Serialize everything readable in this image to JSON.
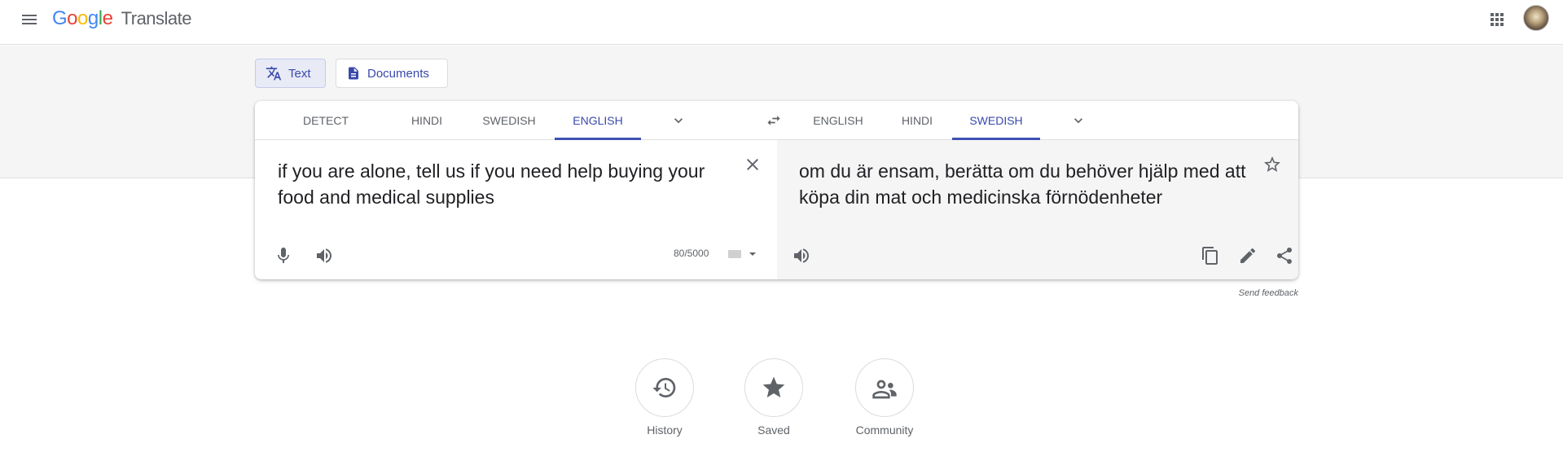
{
  "header": {
    "logo_letters": [
      "G",
      "o",
      "o",
      "g",
      "l",
      "e"
    ],
    "product_name": "Translate",
    "icons": [
      "menu-icon",
      "apps-grid-icon",
      "avatar"
    ]
  },
  "modes": [
    {
      "label": "Text",
      "icon": "translate-icon",
      "active": true
    },
    {
      "label": "Documents",
      "icon": "document-icon",
      "active": false
    }
  ],
  "source_langs": [
    {
      "label": "Detect language",
      "active": false
    },
    {
      "label": "Hindi",
      "active": false
    },
    {
      "label": "Swedish",
      "active": false
    },
    {
      "label": "English",
      "active": true
    }
  ],
  "target_langs": [
    {
      "label": "English",
      "active": false
    },
    {
      "label": "Hindi",
      "active": false
    },
    {
      "label": "Swedish",
      "active": true
    }
  ],
  "source": {
    "text": "if you are alone, tell us if you need help buying your food and medical supplies",
    "char_count": "80/5000"
  },
  "target": {
    "text": "om du är ensam, berätta om du behöver hjälp med att köpa din mat och medicinska förnödenheter"
  },
  "feedback_label": "Send feedback",
  "bottom_actions": [
    {
      "label": "History",
      "icon": "history-icon"
    },
    {
      "label": "Saved",
      "icon": "star-filled-icon"
    },
    {
      "label": "Community",
      "icon": "community-icon"
    }
  ],
  "colors": {
    "accent": "#3f51b5",
    "accent_text": "#3949ab",
    "band_bg": "#f5f5f5",
    "target_bg": "#f5f5f5"
  }
}
